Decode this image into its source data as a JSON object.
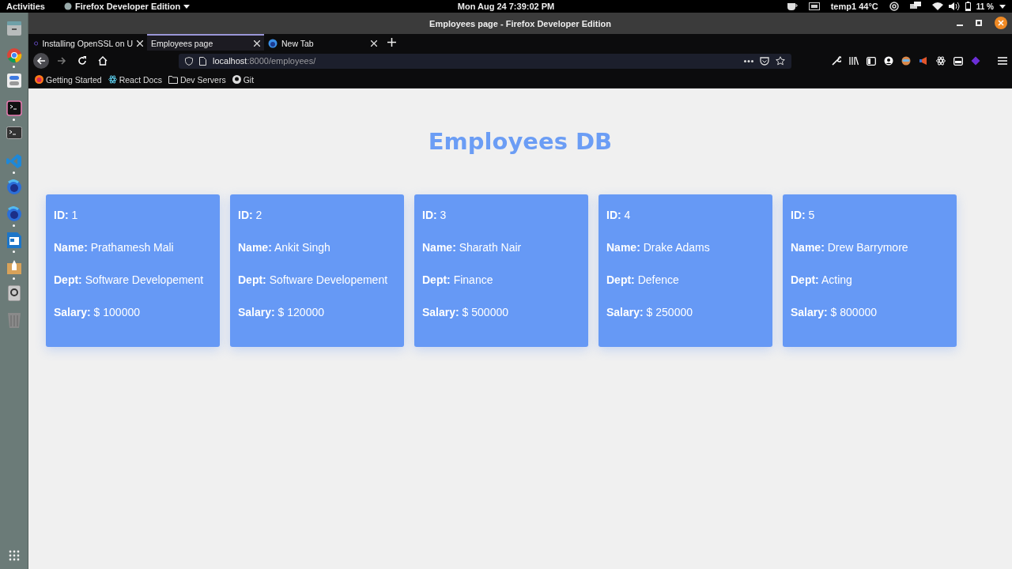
{
  "top_bar": {
    "activities": "Activities",
    "app_menu": "Firefox Developer Edition",
    "clock": "Mon Aug 24  7:39:02 PM",
    "temperature": "temp1 44°C",
    "battery": "11 %"
  },
  "dock": [
    {
      "kind": "files",
      "running": false
    },
    {
      "kind": "chrome",
      "running": true
    },
    {
      "kind": "settings",
      "running": false
    },
    {
      "kind": "terminal-pink",
      "running": true
    },
    {
      "kind": "terminal",
      "running": false
    },
    {
      "kind": "vscode",
      "running": true
    },
    {
      "kind": "firefox",
      "running": false
    },
    {
      "kind": "firefox",
      "running": true
    },
    {
      "kind": "writer",
      "running": true
    },
    {
      "kind": "installer",
      "running": true
    },
    {
      "kind": "disk",
      "running": false
    },
    {
      "kind": "trash",
      "running": false
    }
  ],
  "window": {
    "title": "Employees page - Firefox Developer Edition"
  },
  "tabs": [
    {
      "label": "Installing OpenSSL on U",
      "kind": "site",
      "selected": false
    },
    {
      "label": "Employees page",
      "kind": "none",
      "selected": true
    },
    {
      "label": "New Tab",
      "kind": "firefox",
      "selected": false
    }
  ],
  "address_bar": {
    "host": "localhost",
    "rest": ":8000/employees/"
  },
  "bookmarks": [
    {
      "label": "Getting Started",
      "kind": "firefox"
    },
    {
      "label": "React Docs",
      "kind": "react"
    },
    {
      "label": "Dev Servers",
      "kind": "folder"
    },
    {
      "label": "Git",
      "kind": "github"
    }
  ],
  "page": {
    "heading": "Employees DB",
    "employees": [
      {
        "fields": [
          {
            "label": "ID:",
            "value": "1"
          },
          {
            "label": "Name:",
            "value": "Prathamesh Mali"
          },
          {
            "label": "Dept:",
            "value": "Software Developement"
          },
          {
            "label": "Salary:",
            "value": "$ 100000"
          }
        ]
      },
      {
        "fields": [
          {
            "label": "ID:",
            "value": "2"
          },
          {
            "label": "Name:",
            "value": "Ankit Singh"
          },
          {
            "label": "Dept:",
            "value": "Software Developement"
          },
          {
            "label": "Salary:",
            "value": "$ 120000"
          }
        ]
      },
      {
        "fields": [
          {
            "label": "ID:",
            "value": "3"
          },
          {
            "label": "Name:",
            "value": "Sharath Nair"
          },
          {
            "label": "Dept:",
            "value": "Finance"
          },
          {
            "label": "Salary:",
            "value": "$ 500000"
          }
        ]
      },
      {
        "fields": [
          {
            "label": "ID:",
            "value": "4"
          },
          {
            "label": "Name:",
            "value": "Drake Adams"
          },
          {
            "label": "Dept:",
            "value": "Defence"
          },
          {
            "label": "Salary:",
            "value": "$ 250000"
          }
        ]
      },
      {
        "fields": [
          {
            "label": "ID:",
            "value": "5"
          },
          {
            "label": "Name:",
            "value": "Drew Barrymore"
          },
          {
            "label": "Dept:",
            "value": "Acting"
          },
          {
            "label": "Salary:",
            "value": "$ 800000"
          }
        ]
      }
    ]
  }
}
